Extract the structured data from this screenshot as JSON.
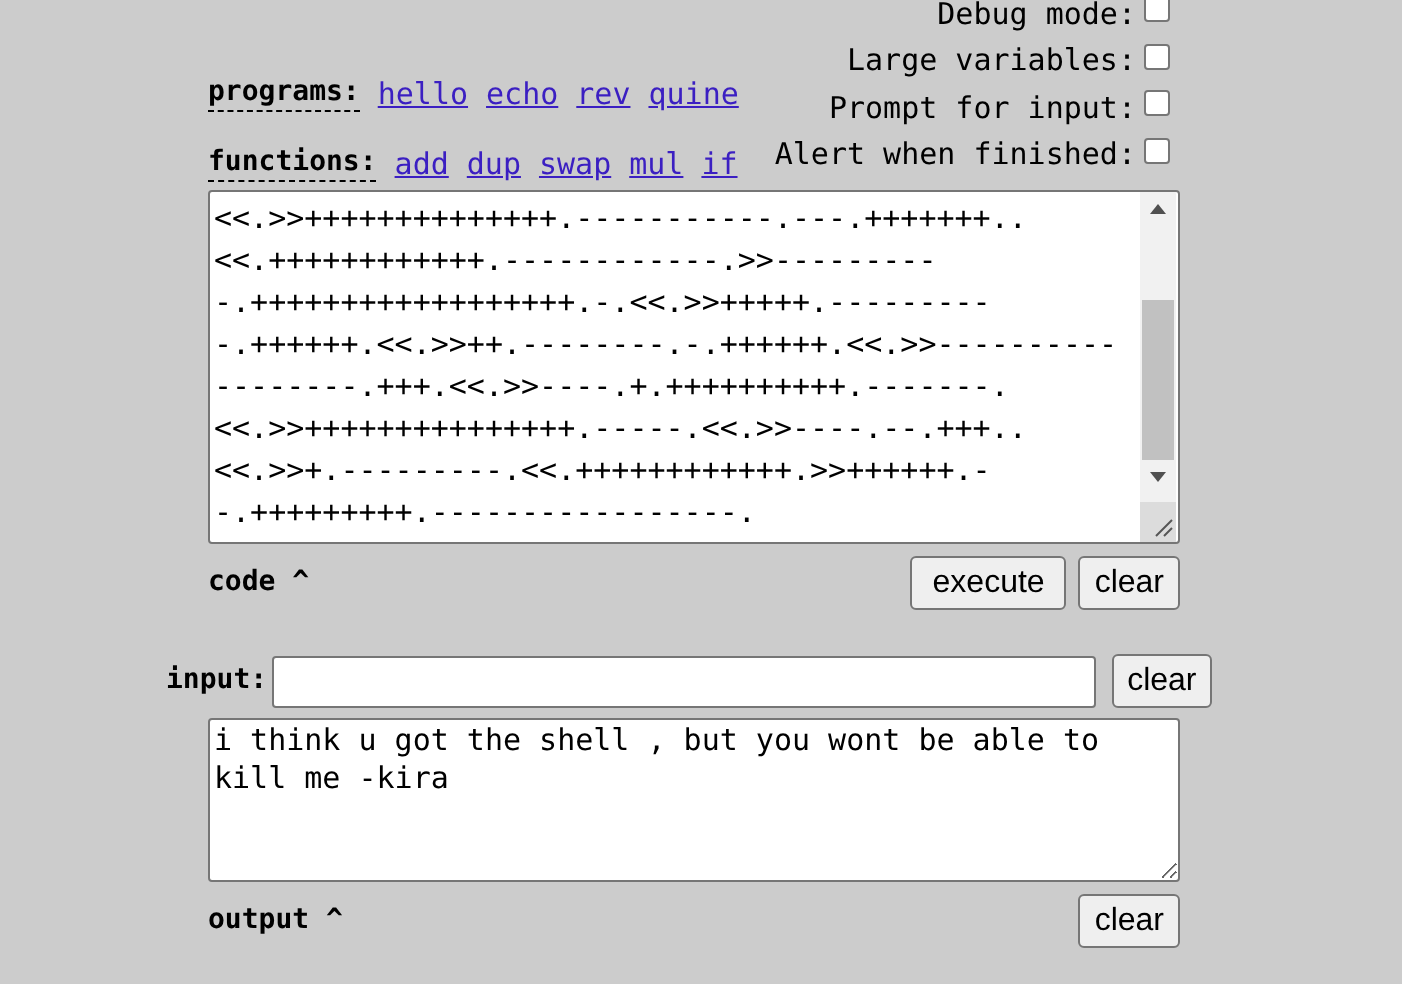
{
  "options": [
    {
      "label": "Debug mode:",
      "checked": false
    },
    {
      "label": "Large variables:",
      "checked": false
    },
    {
      "label": "Prompt for input:",
      "checked": false
    },
    {
      "label": "Alert when finished:",
      "checked": false
    }
  ],
  "programs": {
    "label": "programs:",
    "links": [
      "hello",
      "echo",
      "rev",
      "quine"
    ]
  },
  "functions": {
    "label": "functions:",
    "links": [
      "add",
      "dup",
      "swap",
      "mul",
      "if"
    ]
  },
  "code": {
    "lines": [
      "<<.>>++++++++++++++.-----------.---.+++++++..",
      "<<.++++++++++++.------------.>>---------",
      "-.++++++++++++++++++.-.<<.>>+++++.---------",
      "-.++++++.<<.>>++.--------.-.++++++.<<.>>----------",
      "--------.+++.<<.>>----.+.++++++++++.-------.",
      "<<.>>+++++++++++++++.-----.<<.>>----.--.+++..",
      "<<.>>+.---------.<<.++++++++++++.>>++++++.-",
      "-.+++++++++.-----------------."
    ],
    "label": "code ^",
    "buttons": [
      "execute",
      "clear"
    ]
  },
  "input": {
    "label": "input:",
    "button": "clear"
  },
  "output": {
    "value": "i think u got the shell , but you wont be able to kill me -kira",
    "label": "output ^",
    "button": "clear"
  }
}
